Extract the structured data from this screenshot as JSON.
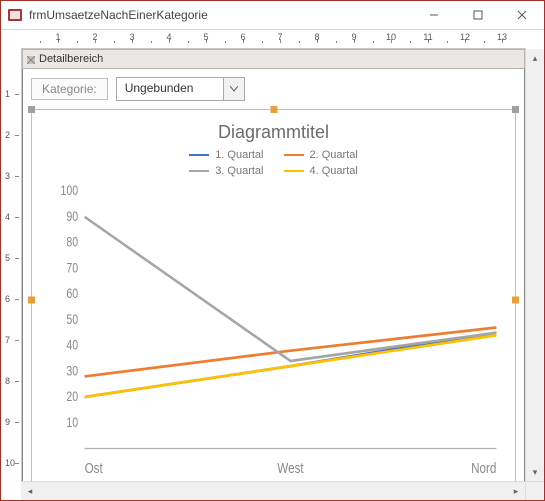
{
  "window": {
    "title": "frmUmsaetzeNachEinerKategorie"
  },
  "section": {
    "label": "Detailbereich"
  },
  "field": {
    "label": "Kategorie:",
    "combo_value": "Ungebunden"
  },
  "ruler_h": [
    "1",
    "2",
    "3",
    "4",
    "5",
    "6",
    "7",
    "8",
    "9",
    "10",
    "11",
    "12",
    "13"
  ],
  "ruler_v": [
    "1",
    "2",
    "3",
    "4",
    "5",
    "6",
    "7",
    "8",
    "9",
    "10"
  ],
  "chart_data": {
    "type": "line",
    "title": "Diagrammtitel",
    "xlabel": "",
    "ylabel": "",
    "ylim": [
      0,
      100
    ],
    "yticks": [
      10,
      20,
      30,
      40,
      50,
      60,
      70,
      80,
      90,
      100
    ],
    "categories": [
      "Ost",
      "West",
      "Nord"
    ],
    "series": [
      {
        "name": "1. Quartal",
        "color": "#4472c4",
        "values": [
          20,
          32,
          45
        ]
      },
      {
        "name": "2. Quartal",
        "color": "#ed7d31",
        "values": [
          28,
          38,
          47
        ]
      },
      {
        "name": "3. Quartal",
        "color": "#a5a5a5",
        "values": [
          90,
          34,
          45
        ]
      },
      {
        "name": "4. Quartal",
        "color": "#ffc000",
        "values": [
          20,
          32,
          44
        ]
      }
    ],
    "legend_position": "top"
  }
}
